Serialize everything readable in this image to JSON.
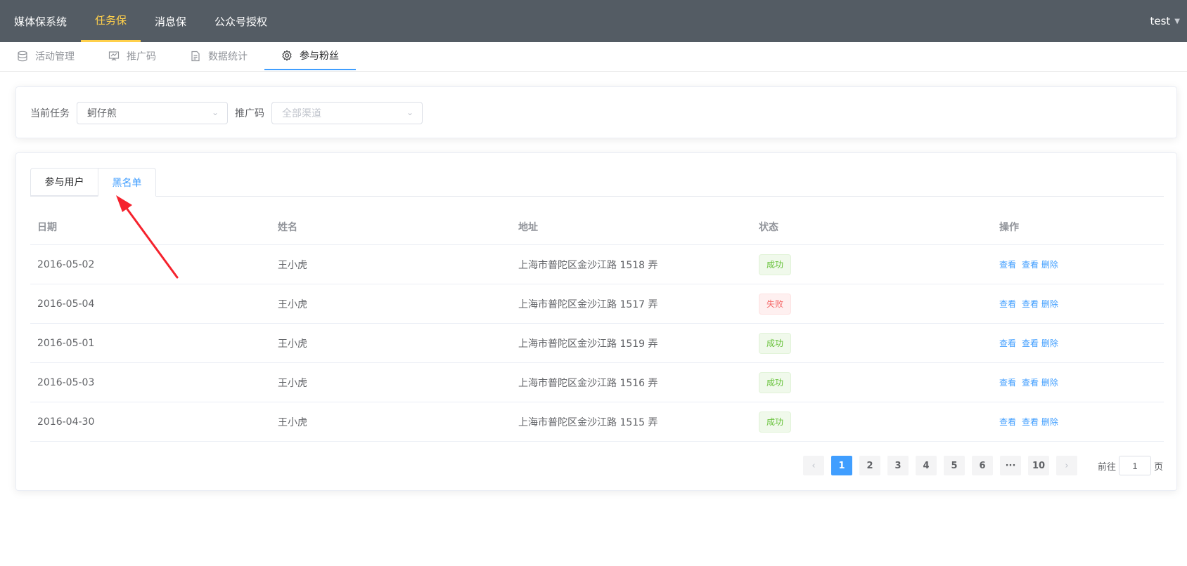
{
  "topnav": {
    "items": [
      {
        "label": "媒体保系统",
        "active": false
      },
      {
        "label": "任务保",
        "active": true
      },
      {
        "label": "消息保",
        "active": false
      },
      {
        "label": "公众号授权",
        "active": false
      }
    ],
    "user": "test"
  },
  "subnav": {
    "items": [
      {
        "label": "活动管理",
        "icon": "database-icon",
        "active": false
      },
      {
        "label": "推广码",
        "icon": "presentation-board-icon",
        "active": false
      },
      {
        "label": "数据统计",
        "icon": "document-icon",
        "active": false
      },
      {
        "label": "参与粉丝",
        "icon": "gear-icon",
        "active": true
      }
    ]
  },
  "filter": {
    "task_label": "当前任务",
    "task_value": "蚵仔煎",
    "code_label": "推广码",
    "code_placeholder": "全部渠道"
  },
  "tabs": [
    {
      "label": "参与用户",
      "active": false
    },
    {
      "label": "黑名单",
      "active": true
    }
  ],
  "table": {
    "headers": [
      "日期",
      "姓名",
      "地址",
      "状态",
      "操作"
    ],
    "rows": [
      {
        "date": "2016-05-02",
        "name": "王小虎",
        "address": "上海市普陀区金沙江路 1518 弄",
        "status": "成功",
        "ok": true
      },
      {
        "date": "2016-05-04",
        "name": "王小虎",
        "address": "上海市普陀区金沙江路 1517 弄",
        "status": "失败",
        "ok": false
      },
      {
        "date": "2016-05-01",
        "name": "王小虎",
        "address": "上海市普陀区金沙江路 1519 弄",
        "status": "成功",
        "ok": true
      },
      {
        "date": "2016-05-03",
        "name": "王小虎",
        "address": "上海市普陀区金沙江路 1516 弄",
        "status": "成功",
        "ok": true
      },
      {
        "date": "2016-04-30",
        "name": "王小虎",
        "address": "上海市普陀区金沙江路 1515 弄",
        "status": "成功",
        "ok": true
      }
    ],
    "action_view": "查看",
    "action_view_delete": "查看 删除"
  },
  "pagination": {
    "prev": "‹",
    "next": "›",
    "pages": [
      "1",
      "2",
      "3",
      "4",
      "5",
      "6",
      "···",
      "10"
    ],
    "current": "1",
    "goto_label": "前往",
    "goto_value": "1",
    "page_suffix": "页"
  },
  "colors": {
    "topbar": "#545c64",
    "active_nav": "#ffd04b",
    "primary": "#409eff",
    "success": "#67c23a",
    "danger": "#f56c6c",
    "annotation": "#f5222d"
  }
}
